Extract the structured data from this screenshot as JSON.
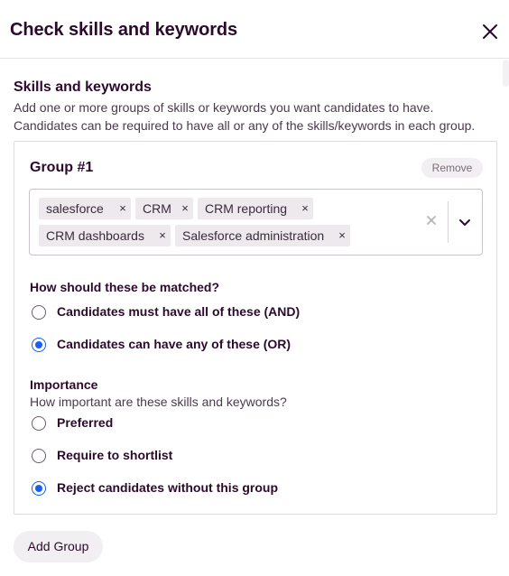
{
  "dialog": {
    "title": "Check skills and keywords",
    "close_icon": "close-icon"
  },
  "section": {
    "title": "Skills and keywords",
    "description": "Add one or more groups of skills or keywords you want candidates to have. Candidates can be required to have all or any of the skills/keywords in each group."
  },
  "group": {
    "title": "Group #1",
    "remove_label": "Remove",
    "tags": [
      "salesforce",
      "CRM",
      "CRM reporting",
      "CRM dashboards",
      "Salesforce administration"
    ],
    "tag_remove_glyph": "×",
    "match_question": "How should these be matched?",
    "match_options": [
      {
        "label": "Candidates must have all of these (AND)",
        "checked": false
      },
      {
        "label": "Candidates can have any of these (OR)",
        "checked": true
      }
    ],
    "importance_title": "Importance",
    "importance_subtitle": "How important are these skills and keywords?",
    "importance_options": [
      {
        "label": "Preferred",
        "checked": false
      },
      {
        "label": "Require to shortlist",
        "checked": false
      },
      {
        "label": "Reject candidates without this group",
        "checked": true
      }
    ]
  },
  "add_group_label": "Add Group",
  "colors": {
    "text_primary": "#2b0a2c",
    "radio_selected": "#1a5ef0",
    "tag_background": "#ede9ed",
    "pill_background": "#f1eff1"
  }
}
